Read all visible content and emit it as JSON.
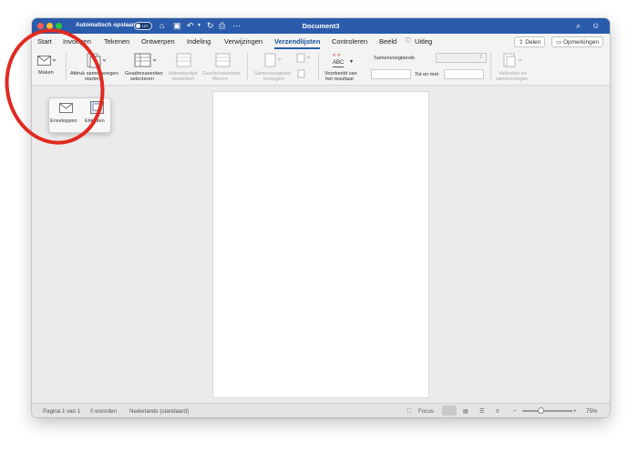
{
  "window": {
    "title": "Document3",
    "autosave_label": "Automatisch opslaan",
    "autosave_state": "UIT"
  },
  "tabs": [
    "Start",
    "Invoegen",
    "Tekenen",
    "Ontwerpen",
    "Indeling",
    "Verwijzingen",
    "Verzendlijsten",
    "Controleren",
    "Beeld",
    "Uitleg"
  ],
  "active_tab": "Verzendlijsten",
  "header_buttons": {
    "share": "Delen",
    "comments": "Opmerkingen"
  },
  "ribbon": {
    "maken": "Maken",
    "afdruk_1": "Afdruk samenvoegen",
    "afdruk_2": "starten",
    "geadres_1": "Geadresseerden",
    "geadres_2": "selecteren",
    "adreslijst_1": "Adressenlijst",
    "adreslijst_2": "bewerken",
    "geadresfilter_1": "Geadresseerden",
    "geadresfilter_2": "filteren",
    "samenveld_1": "Samenvoegveld",
    "samenveld_2": "invoegen",
    "voorbeeld_1": "Voorbeeld van",
    "voorbeeld_2": "het resultaat",
    "voorbeeld_icon": "ABC",
    "bereik_label": "Samenvoegbereik",
    "tot_en_met": "Tot en met",
    "voltooien_1": "Voltooien en",
    "voltooien_2": "samenvoegen"
  },
  "popup": {
    "enveloppen": "Enveloppen",
    "etiketten": "Etiketten"
  },
  "status": {
    "page": "Pagina 1 van 1",
    "words": "0 woorden",
    "language": "Nederlands (standaard)",
    "focus": "Focus",
    "zoom": "75%"
  },
  "colors": {
    "titlebar": "#2b5cab",
    "annotation": "#e02b20"
  }
}
